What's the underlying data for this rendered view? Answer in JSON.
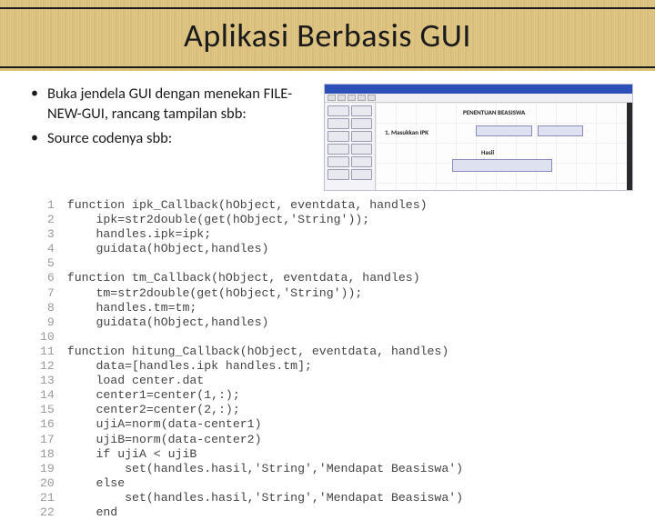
{
  "title": "Aplikasi Berbasis GUI",
  "bullets": [
    "Buka jendela GUI dengan menekan FILE-NEW-GUI, rancang tampilan sbb:",
    "Source codenya sbb:"
  ],
  "gui": {
    "heading": "PENENTUAN BEASISWA",
    "row_label": "1. Masukkan IPK",
    "button_label": "Hasil"
  },
  "code": {
    "lines": [
      "function ipk_Callback(hObject, eventdata, handles)",
      "    ipk=str2double(get(hObject,'String'));",
      "    handles.ipk=ipk;",
      "    guidata(hObject,handles)",
      "",
      "function tm_Callback(hObject, eventdata, handles)",
      "    tm=str2double(get(hObject,'String'));",
      "    handles.tm=tm;",
      "    guidata(hObject,handles)",
      "",
      "function hitung_Callback(hObject, eventdata, handles)",
      "    data=[handles.ipk handles.tm];",
      "    load center.dat",
      "    center1=center(1,:);",
      "    center2=center(2,:);",
      "    ujiA=norm(data-center1)",
      "    ujiB=norm(data-center2)",
      "    if ujiA < ujiB",
      "        set(handles.hasil,'String','Mendapat Beasiswa')",
      "    else",
      "        set(handles.hasil,'String','Mendapat Beasiswa')",
      "    end"
    ]
  }
}
